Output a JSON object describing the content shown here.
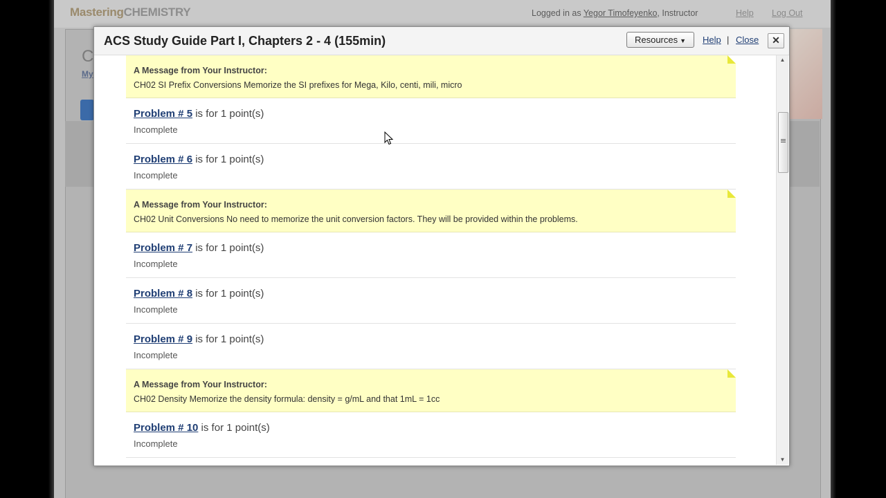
{
  "app": {
    "logo_part1": "Mastering",
    "logo_part2": "CHEMISTRY",
    "logged_in_prefix": "Logged in as",
    "user_name": "Yegor Timofeyenko",
    "user_role": ", Instructor",
    "help_label": "Help",
    "logout_label": "Log Out",
    "bg_title": "C",
    "bg_link": "My"
  },
  "modal": {
    "title": "ACS Study Guide Part I, Chapters 2 - 4 (155min)",
    "resources_label": "Resources",
    "help_label": "Help",
    "separator": "|",
    "close_label": "Close",
    "close_icon_glyph": "✕"
  },
  "items": [
    {
      "type": "message",
      "title": "A Message from Your Instructor:",
      "text": "CH02 SI Prefix Conversions Memorize the SI prefixes for Mega, Kilo, centi, mili, micro"
    },
    {
      "type": "problem",
      "link": "Problem # 5",
      "suffix": " is for 1 point(s)",
      "status": "Incomplete"
    },
    {
      "type": "problem",
      "link": "Problem # 6",
      "suffix": " is for 1 point(s)",
      "status": "Incomplete"
    },
    {
      "type": "message",
      "title": "A Message from Your Instructor:",
      "text": "CH02 Unit Conversions No need to memorize the unit conversion factors. They will be provided within the problems."
    },
    {
      "type": "problem",
      "link": "Problem # 7",
      "suffix": " is for 1 point(s)",
      "status": "Incomplete"
    },
    {
      "type": "problem",
      "link": "Problem # 8",
      "suffix": " is for 1 point(s)",
      "status": "Incomplete"
    },
    {
      "type": "problem",
      "link": "Problem # 9",
      "suffix": " is for 1 point(s)",
      "status": "Incomplete"
    },
    {
      "type": "message",
      "title": "A Message from Your Instructor:",
      "text": "CH02 Density Memorize the density formula: density = g/mL and that 1mL = 1cc"
    },
    {
      "type": "problem",
      "link": "Problem # 10",
      "suffix": " is for 1 point(s)",
      "status": "Incomplete"
    }
  ],
  "colors": {
    "message_bg": "#ffffc4",
    "link": "#1f3e74",
    "corner_accent": "#e8e83a"
  },
  "icons": {
    "scroll_up": "▲",
    "scroll_down": "▼",
    "dropdown": "▼"
  }
}
